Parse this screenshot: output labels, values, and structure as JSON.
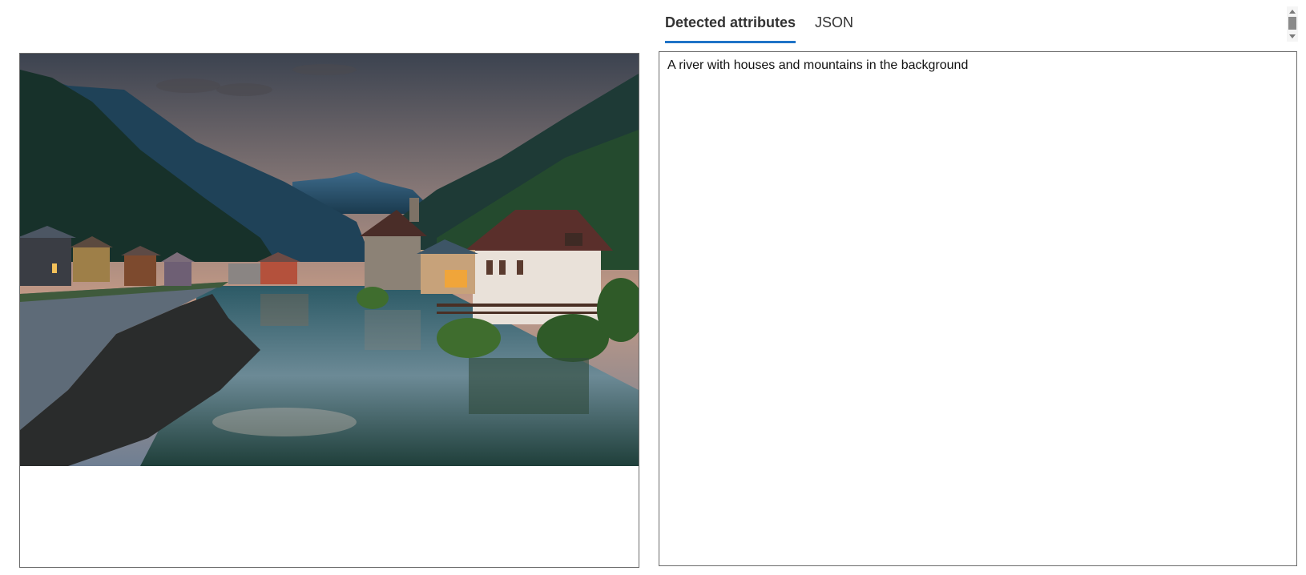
{
  "tabs": [
    {
      "label": "Detected attributes",
      "active": true
    },
    {
      "label": "JSON",
      "active": false
    }
  ],
  "result": {
    "caption": "A river with houses and mountains in the background"
  },
  "accent_color": "#1f73c7"
}
